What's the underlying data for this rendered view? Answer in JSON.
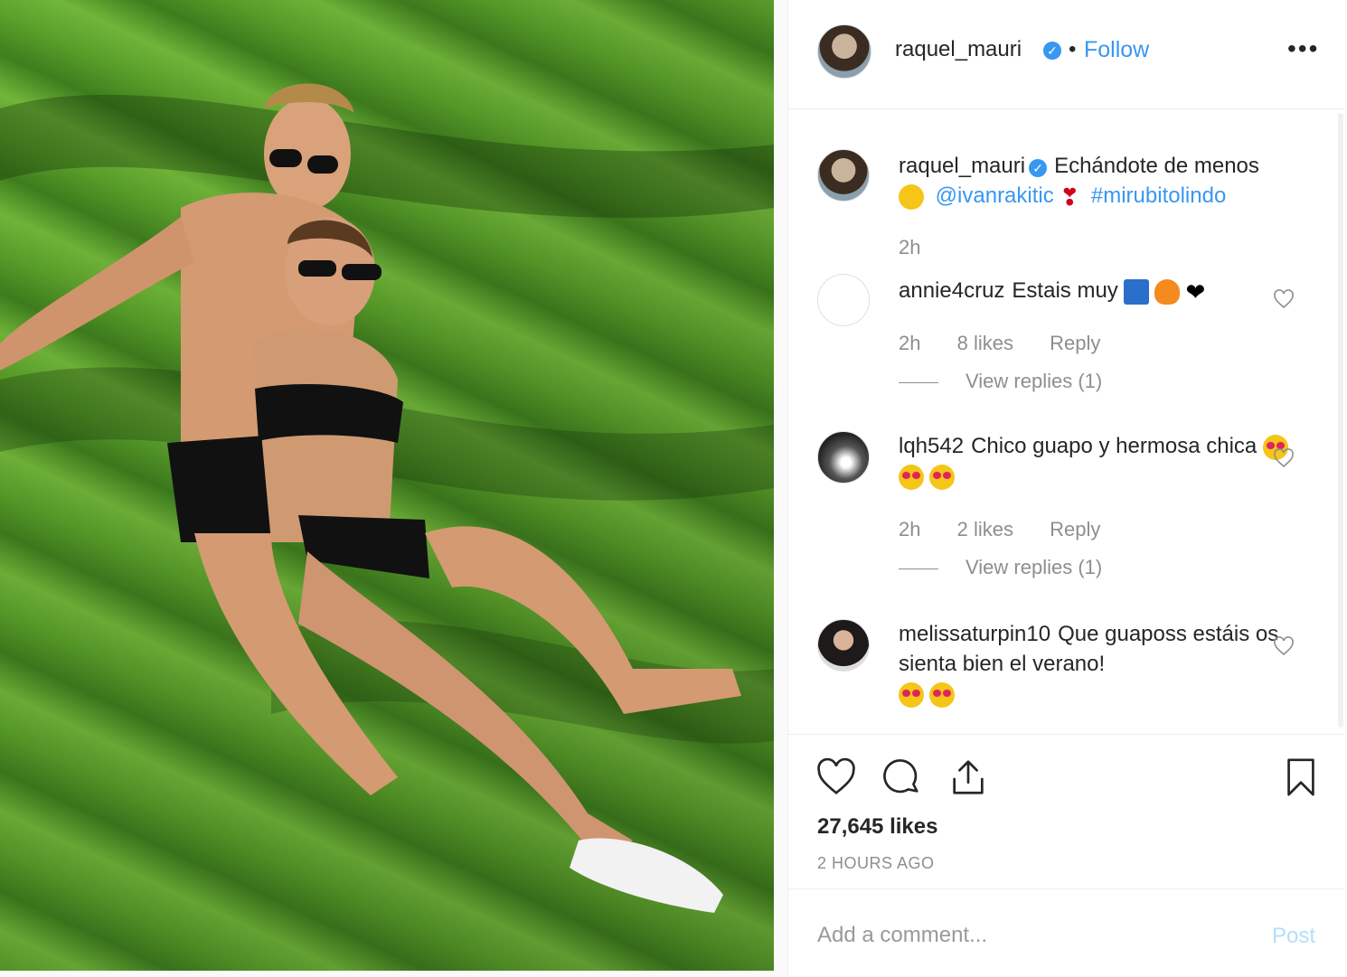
{
  "header": {
    "username": "raquel_mauri",
    "separator": "•",
    "follow_label": "Follow",
    "more_label": "•••"
  },
  "caption": {
    "username": "raquel_mauri",
    "text_start": "Echándote de menos",
    "mention": "@ivanrakitic",
    "hashtag": "#mirubitolindo",
    "time": "2h"
  },
  "comments": [
    {
      "username": "annie4cruz",
      "text": "Estais muy",
      "time": "2h",
      "likes": "8 likes",
      "reply_label": "Reply",
      "view_replies": "View replies (1)"
    },
    {
      "username": "lqh542",
      "text": "Chico guapo y hermosa chica",
      "time": "2h",
      "likes": "2 likes",
      "reply_label": "Reply",
      "view_replies": "View replies (1)"
    },
    {
      "username": "melissaturpin10",
      "text": "Que guaposs estáis os sienta bien el verano!"
    }
  ],
  "actions": {
    "likes_count": "27,645 likes",
    "timestamp": "2 hours ago"
  },
  "add_comment": {
    "placeholder": "Add a comment...",
    "post_label": "Post"
  },
  "colors": {
    "link_blue": "#3897f0",
    "muted": "#8e8e8e",
    "post_disabled": "#b2dffc"
  }
}
